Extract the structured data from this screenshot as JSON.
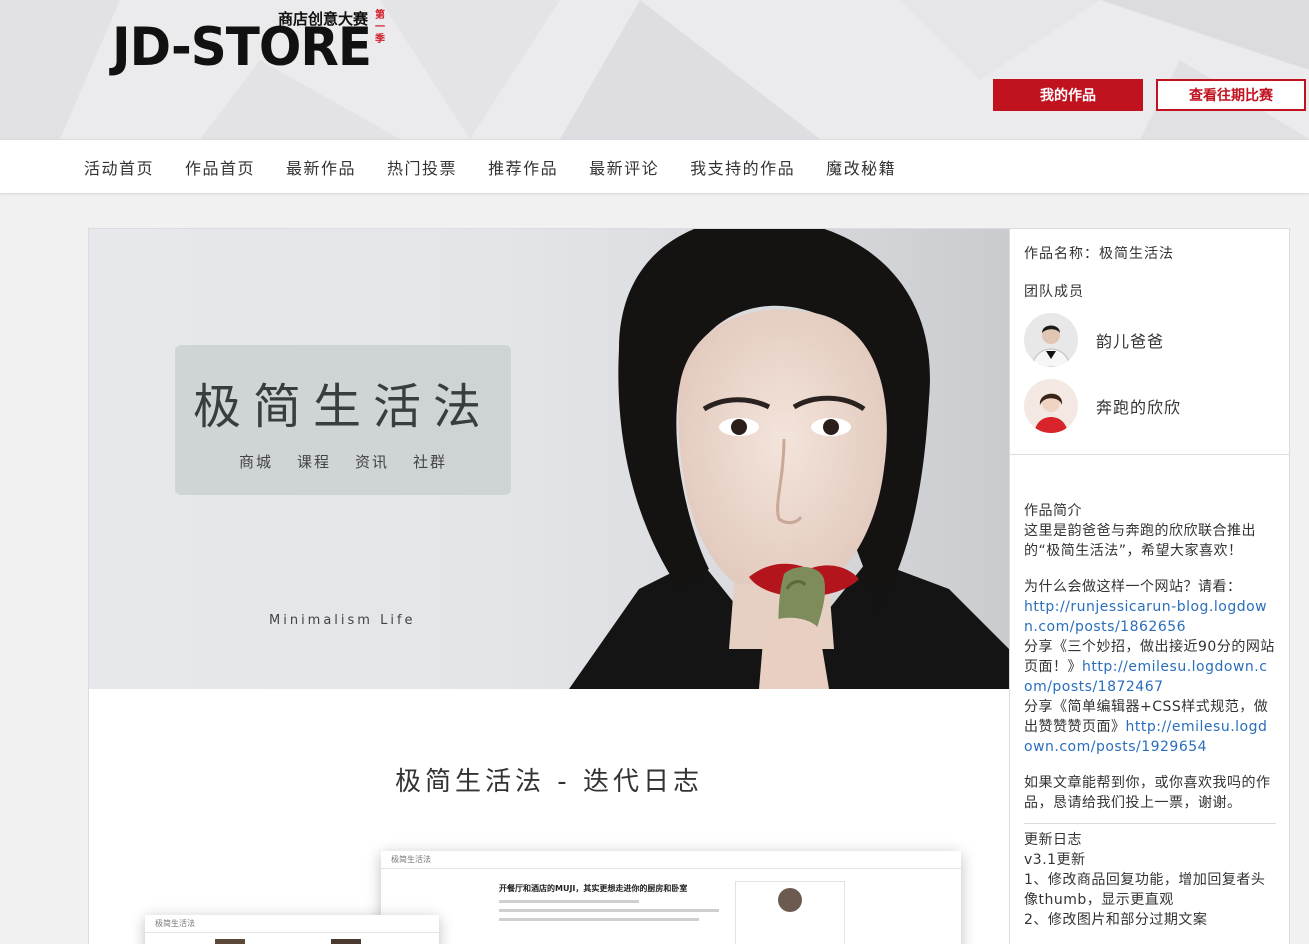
{
  "header": {
    "logo_main": "JD-STORE",
    "logo_sub": "商店创意大赛",
    "logo_season": "第一季",
    "my_works_label": "我的作品",
    "past_contests_label": "查看往期比赛",
    "accent_color": "#c1121f"
  },
  "nav": {
    "items": [
      "活动首页",
      "作品首页",
      "最新作品",
      "热门投票",
      "推荐作品",
      "最新评论",
      "我支持的作品",
      "魔改秘籍"
    ]
  },
  "hero": {
    "title": "极简生活法",
    "links": [
      "商城",
      "课程",
      "资讯",
      "社群"
    ],
    "caption": "Minimalism Life"
  },
  "main": {
    "section_title": "极简生活法 - 迭代日志",
    "shot1": {
      "brand": "极简生活法",
      "headline": "开餐厅和酒店的MUJI，其实更想走进你的厨房和卧室"
    },
    "shot2": {
      "brand": "极简生活法"
    }
  },
  "side": {
    "work_name_label": "作品名称：",
    "work_name": "极简生活法",
    "team_label": "团队成员",
    "members": [
      {
        "name": "韵儿爸爸",
        "icon": "avatar-man"
      },
      {
        "name": "奔跑的欣欣",
        "icon": "avatar-woman"
      }
    ],
    "intro_label": "作品简介",
    "intro_text": "这里是韵爸爸与奔跑的欣欣联合推出的“极简生活法”，希望大家喜欢！",
    "why_text": "为什么会做这样一个网站？请看：",
    "link1": "http://runjessicarun-blog.logdown.com/posts/1862656",
    "share1_text": "分享《三个妙招，做出接近90分的网站页面！》",
    "link2": "http://emilesu.logdown.com/posts/1872467",
    "share2_text": "分享《简单编辑器+CSS样式规范，做出赞赞赞页面》",
    "link3": "http://emilesu.logdown.com/posts/1929654",
    "closing_text": "如果文章能帮到你，或你喜欢我吗的作品，恳请给我们投上一票，谢谢。",
    "changelog_label": "更新日志",
    "version": "v3.1更新",
    "change1": "1、修改商品回复功能，增加回复者头像thumb，显示更直观",
    "change2": "2、修改图片和部分过期文案"
  }
}
